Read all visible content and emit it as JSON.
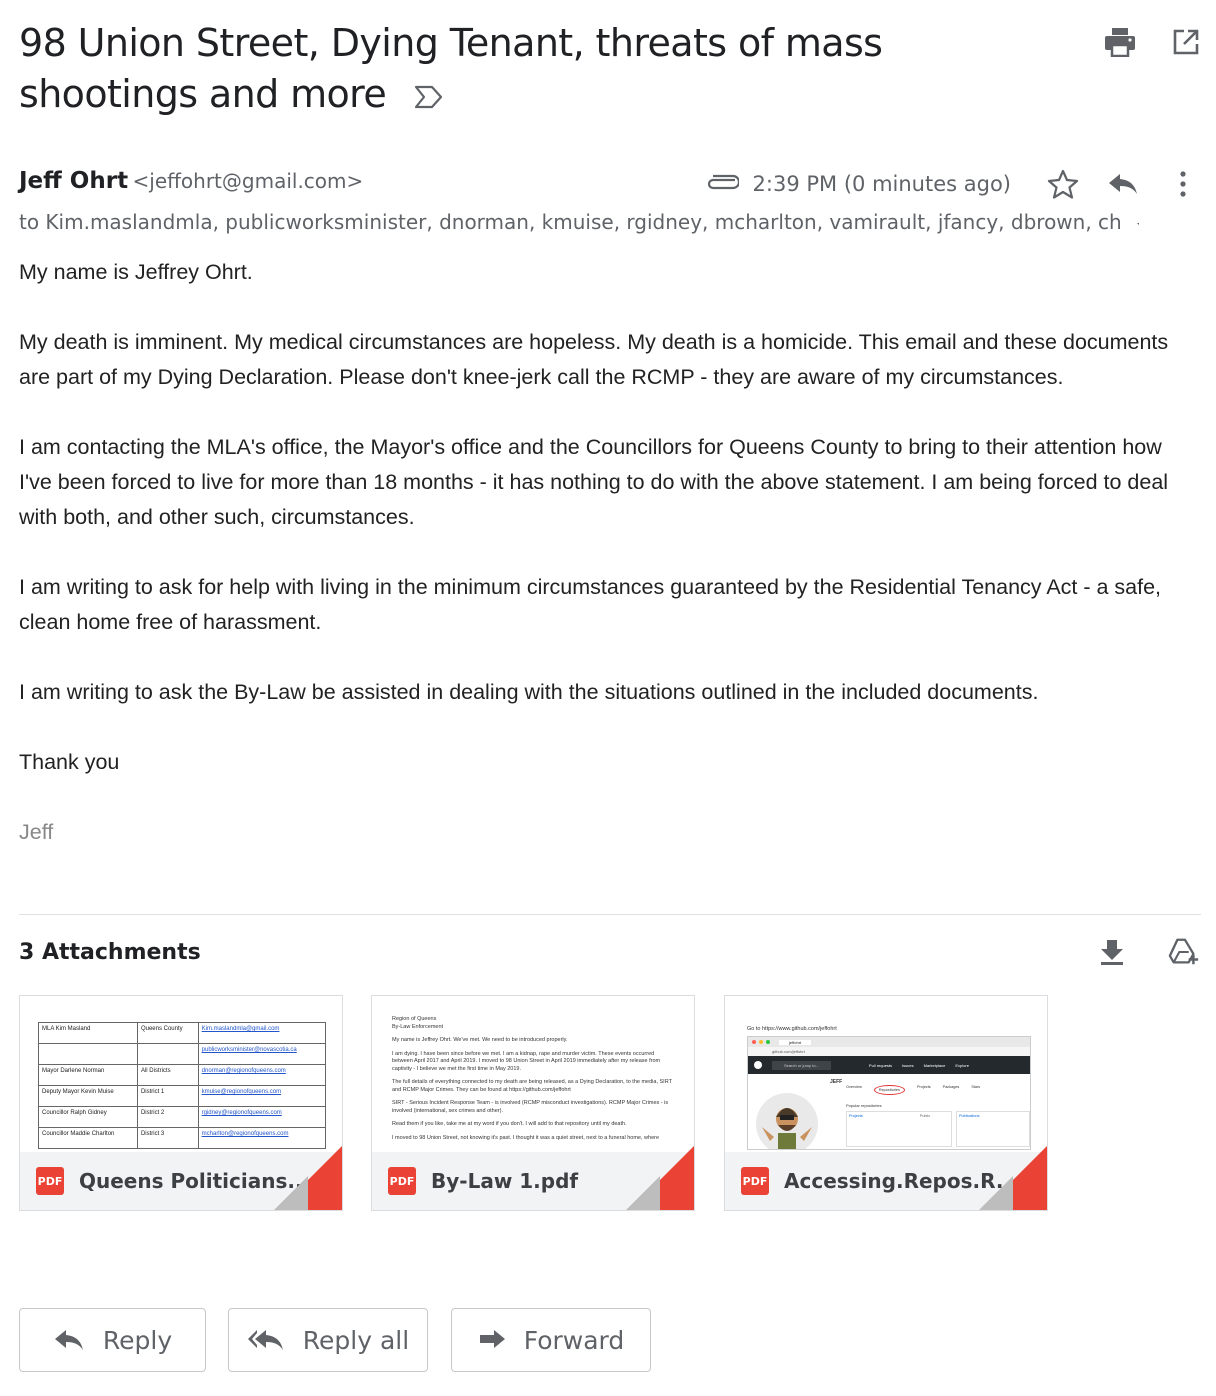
{
  "subject": "98 Union Street, Dying Tenant, threats of mass shootings and more",
  "sender": {
    "name": "Jeff Ohrt",
    "email": "<jeffohrt@gmail.com>"
  },
  "timestamp": "2:39 PM (0 minutes ago)",
  "recipients": "to Kim.maslandmla, publicworksminister, dnorman, kmuise, rgidney, mcharlton, vamirault, jfancy, dbrown, ch",
  "body": {
    "p1": "My name is Jeffrey Ohrt.",
    "p2": "My death is imminent.  My medical circumstances are hopeless.  My death is a homicide.  This email and these documents are part of my Dying Declaration.  Please don't knee-jerk call the RCMP - they are aware of my circumstances.",
    "p3": "I am contacting the MLA's office, the Mayor's office and the Councillors for Queens County to bring to their attention how I've been forced to live for more than 18 months -  it has nothing to do with the above statement.  I am being forced to deal with both, and other such, circumstances.",
    "p4": "I am writing to ask for help with living in the minimum circumstances guaranteed by the Residential Tenancy Act - a safe, clean home free of harassment.",
    "p5": "I am writing to ask the By-Law be assisted in dealing with the situations outlined in the included documents.",
    "p6": "Thank you",
    "signature": "Jeff"
  },
  "attachments": {
    "header": "3 Attachments",
    "badge": "PDF",
    "items": [
      {
        "name": "Queens Politicians...."
      },
      {
        "name": "By-Law 1.pdf"
      },
      {
        "name": "Accessing.Repos.R..."
      }
    ],
    "preview1": {
      "rows": [
        [
          "MLA Kim Masland",
          "Queens County",
          "Kim.maslandmla@gmail.com"
        ],
        [
          "",
          "",
          "publicworksminister@novascotia.ca"
        ],
        [
          "Mayor Darlene Norman",
          "All Districts",
          "dnorman@regionofqueens.com"
        ],
        [
          "Deputy Mayor Kevin Muise",
          "District 1",
          "kmuise@regionofqueens.com"
        ],
        [
          "Councillor Ralph Gidney",
          "District 2",
          "rgidney@regionofqueens.com"
        ],
        [
          "Councillor Maddie Charlton",
          "District 3",
          "mcharlton@regionofqueens.com"
        ]
      ]
    },
    "preview2": {
      "lines": [
        "Region of Queens",
        "By-Law Enforcement",
        "My name is Jeffrey Ohrt.  We've met.  We need to be introduced properly.",
        "I am dying.  I have been since before we met.  I am a kidnap, rape and murder victim.  These events occurred between April 2017 and April 2019.  I moved to 98 Union Street in April 2019 immediately after my release from captivity - I believe we met the first time in May 2019.",
        "The full details of everything connected to my death are being released, as a Dying Declaration, to the media, SIRT and RCMP Major Crimes.  They can be found at https://github.com/jeffohrt",
        "SIRT - Serious Incident Response Team - is involved (RCMP misconduct investigations). RCMP Major Crimes - is involved (international, sex crimes and other).",
        "Read them if you like, take me at my word if you don't.  I will add to that repository until my death.",
        "I moved to 98 Union Street, not knowing it's past.  I thought it was a quiet street, next to a funeral home, where"
      ]
    },
    "preview3": {
      "goto": "Go to https://www.github.com/jeffohrt",
      "tab_label": "jeffohrt",
      "url": "github.com/jeffohrt",
      "search_placeholder": "Search or jump to...",
      "nav": [
        "Pull requests",
        "Issues",
        "Marketplace",
        "Explore"
      ],
      "profile_tabs": [
        "Overview",
        "Repositories",
        "Projects",
        "Packages",
        "Stars"
      ],
      "popular": "Popular repositories",
      "repos": [
        "Projects",
        "Public",
        "Publications"
      ],
      "avatar_text": "JEFF"
    }
  },
  "actions": {
    "reply": "Reply",
    "reply_all": "Reply all",
    "forward": "Forward"
  },
  "colors": {
    "pdf_red": "#ea4335",
    "text": "#202124",
    "muted": "#5f6368"
  }
}
